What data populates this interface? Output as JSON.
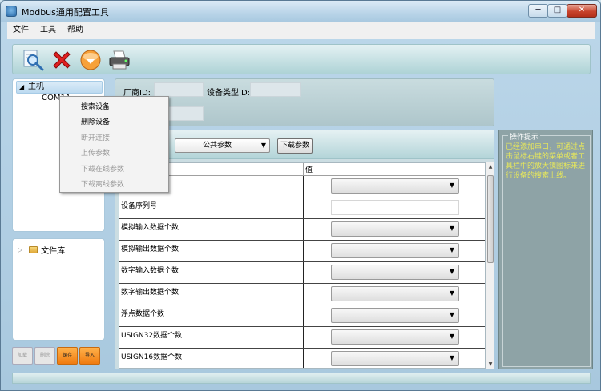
{
  "window": {
    "title": "Modbus通用配置工具",
    "min_glyph": "─",
    "max_glyph": "□",
    "close_glyph": "✕"
  },
  "menu": [
    {
      "label": "文件"
    },
    {
      "label": "工具"
    },
    {
      "label": "帮助"
    }
  ],
  "toolbar": {
    "icons": [
      "search-icon",
      "delete-icon",
      "upload-icon",
      "printer-icon"
    ]
  },
  "tree": {
    "root_label": "主机",
    "root_arrow": "◢",
    "child_label": "COM11"
  },
  "library": {
    "label": "文件库",
    "arrow": "▷"
  },
  "left_buttons": [
    {
      "label": "加载",
      "state": "disabled"
    },
    {
      "label": "删除",
      "state": "disabled"
    },
    {
      "label": "保存",
      "state": "active"
    },
    {
      "label": "导入",
      "state": "active"
    }
  ],
  "info": {
    "vendor_label": "厂商ID:",
    "device_type_label": "设备类型ID:"
  },
  "params": {
    "selected_group": "公共参数",
    "download_label": "下载参数",
    "value_header": "值",
    "rows": [
      {
        "label": "",
        "kind": "combo"
      },
      {
        "label": "设备序列号",
        "kind": "input"
      },
      {
        "label": "模拟输入数据个数",
        "kind": "combo"
      },
      {
        "label": "模拟输出数据个数",
        "kind": "combo"
      },
      {
        "label": "数字输入数据个数",
        "kind": "combo"
      },
      {
        "label": "数字输出数据个数",
        "kind": "combo"
      },
      {
        "label": "浮点数据个数",
        "kind": "combo"
      },
      {
        "label": "USIGN32数据个数",
        "kind": "combo"
      },
      {
        "label": "USIGN16数据个数",
        "kind": "combo"
      }
    ]
  },
  "hint": {
    "title": "操作提示",
    "text": "已经添加串口，可通过点击鼠标右键的菜单或者工具栏中的放大镜图标来进行设备的搜索上线。"
  },
  "context_menu": [
    {
      "label": "搜索设备",
      "enabled": true
    },
    {
      "label": "删除设备",
      "enabled": true
    },
    {
      "label": "断开连接",
      "enabled": false
    },
    {
      "label": "上传参数",
      "enabled": false
    },
    {
      "label": "下载在线参数",
      "enabled": false
    },
    {
      "label": "下载离线参数",
      "enabled": false
    }
  ],
  "colors": {
    "hint_text": "#e8e85a",
    "save_button": "#f07b10",
    "close_button": "#c8432c"
  }
}
